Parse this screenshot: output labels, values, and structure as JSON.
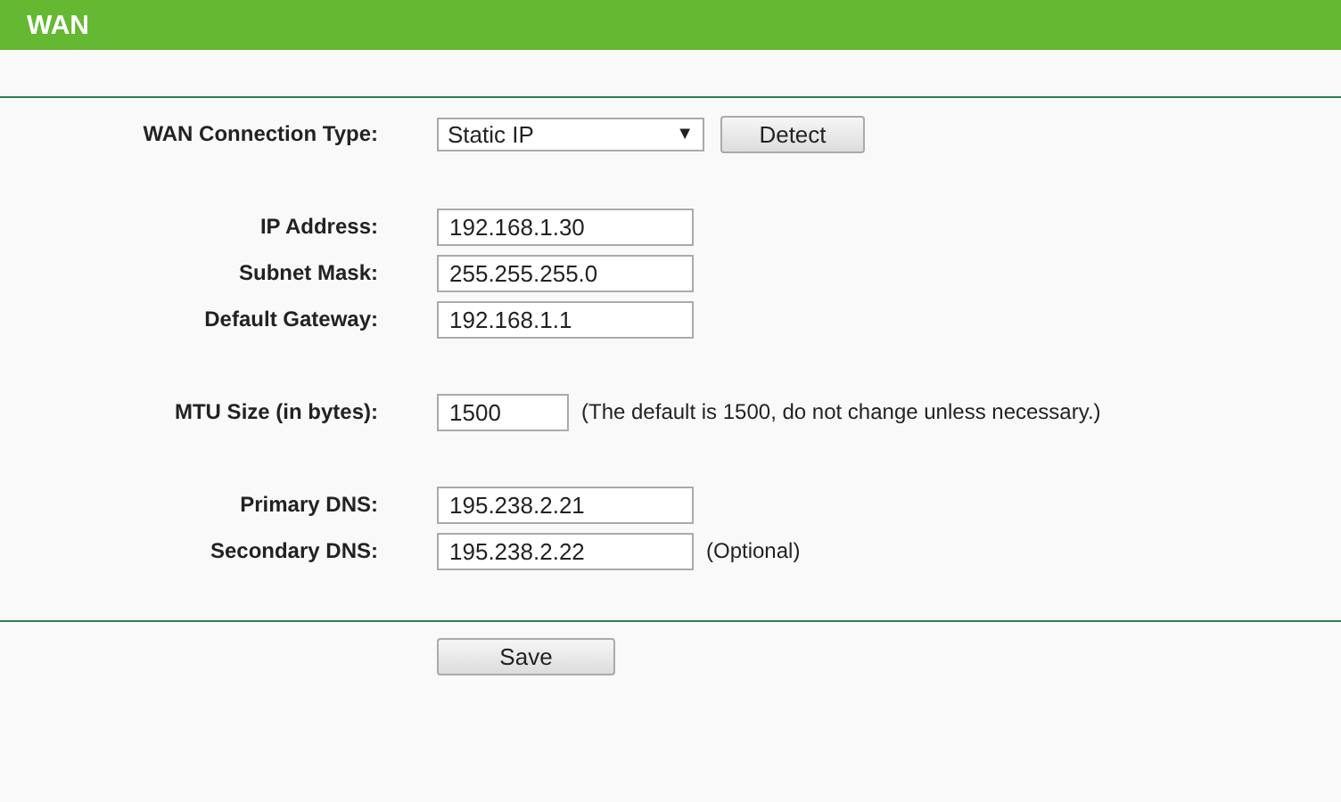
{
  "header": {
    "title": "WAN"
  },
  "groups": [
    {
      "rows": [
        {
          "label": "WAN Connection Type:",
          "kind": "select",
          "value": "Static IP",
          "arrow": "▼",
          "button": "Detect"
        }
      ]
    },
    {
      "rows": [
        {
          "label": "IP Address:",
          "kind": "wide",
          "value": "192.168.1.30"
        },
        {
          "label": "Subnet Mask:",
          "kind": "wide",
          "value": "255.255.255.0"
        },
        {
          "label": "Default Gateway:",
          "kind": "wide",
          "value": "192.168.1.1"
        }
      ]
    },
    {
      "rows": [
        {
          "label": "MTU Size (in bytes):",
          "kind": "short",
          "value": "1500",
          "note": "(The default is 1500, do not change unless necessary.)"
        }
      ]
    },
    {
      "rows": [
        {
          "label": "Primary DNS:",
          "kind": "wide",
          "value": "195.238.2.21"
        },
        {
          "label": "Secondary DNS:",
          "kind": "wide",
          "value": "195.238.2.22",
          "note": "(Optional)"
        }
      ]
    }
  ],
  "save_button": "Save"
}
